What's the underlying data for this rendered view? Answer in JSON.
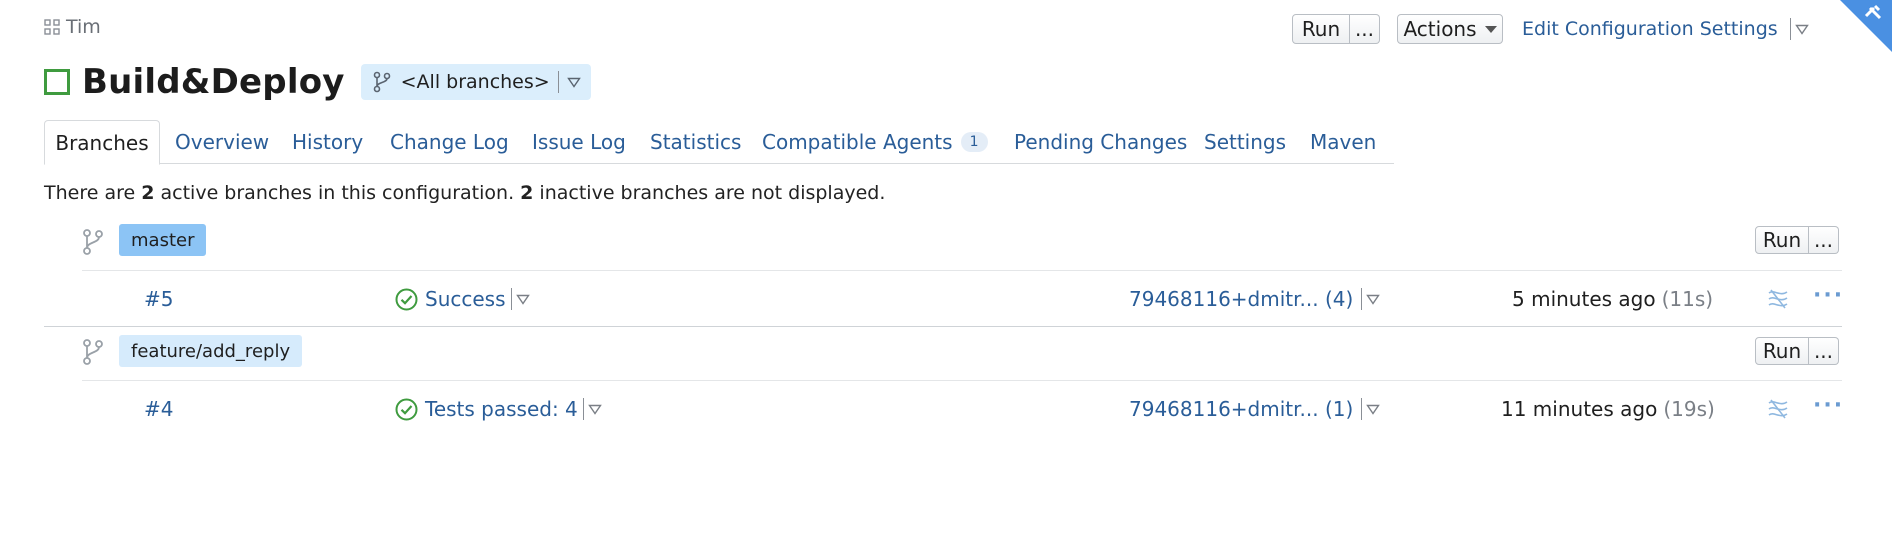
{
  "breadcrumb": {
    "project": "Tim"
  },
  "header": {
    "run_label": "Run",
    "more_label": "...",
    "actions_label": "Actions",
    "edit_config_label": "Edit Configuration Settings"
  },
  "page": {
    "title": "Build&Deploy",
    "branch_selector": "<All branches>"
  },
  "tabs": [
    {
      "label": "Branches"
    },
    {
      "label": "Overview"
    },
    {
      "label": "History"
    },
    {
      "label": "Change Log"
    },
    {
      "label": "Issue Log"
    },
    {
      "label": "Statistics"
    },
    {
      "label": "Compatible Agents",
      "badge": "1"
    },
    {
      "label": "Pending Changes"
    },
    {
      "label": "Settings"
    },
    {
      "label": "Maven"
    }
  ],
  "summary": {
    "prefix": "There are ",
    "active_count": "2",
    "middle": " active branches in this configuration. ",
    "inactive_count": "2",
    "suffix": " inactive branches are not displayed."
  },
  "branches": [
    {
      "name": "master",
      "run_label": "Run",
      "more_label": "...",
      "build": {
        "number": "#5",
        "status": "Success",
        "changes": "79468116+dmitr... (4)",
        "time": "5 minutes ago",
        "duration": "(11s)"
      }
    },
    {
      "name": "feature/add_reply",
      "run_label": "Run",
      "more_label": "...",
      "build": {
        "number": "#4",
        "status": "Tests passed: 4",
        "changes": "79468116+dmitr... (1)",
        "time": "11 minutes ago",
        "duration": "(19s)"
      }
    }
  ],
  "colors": {
    "link": "#2a5d98",
    "success": "#3f9b3f",
    "master_tag": "#8cc4f5",
    "branch_tag": "#d6ebfc",
    "corner": "#4a90e2"
  }
}
